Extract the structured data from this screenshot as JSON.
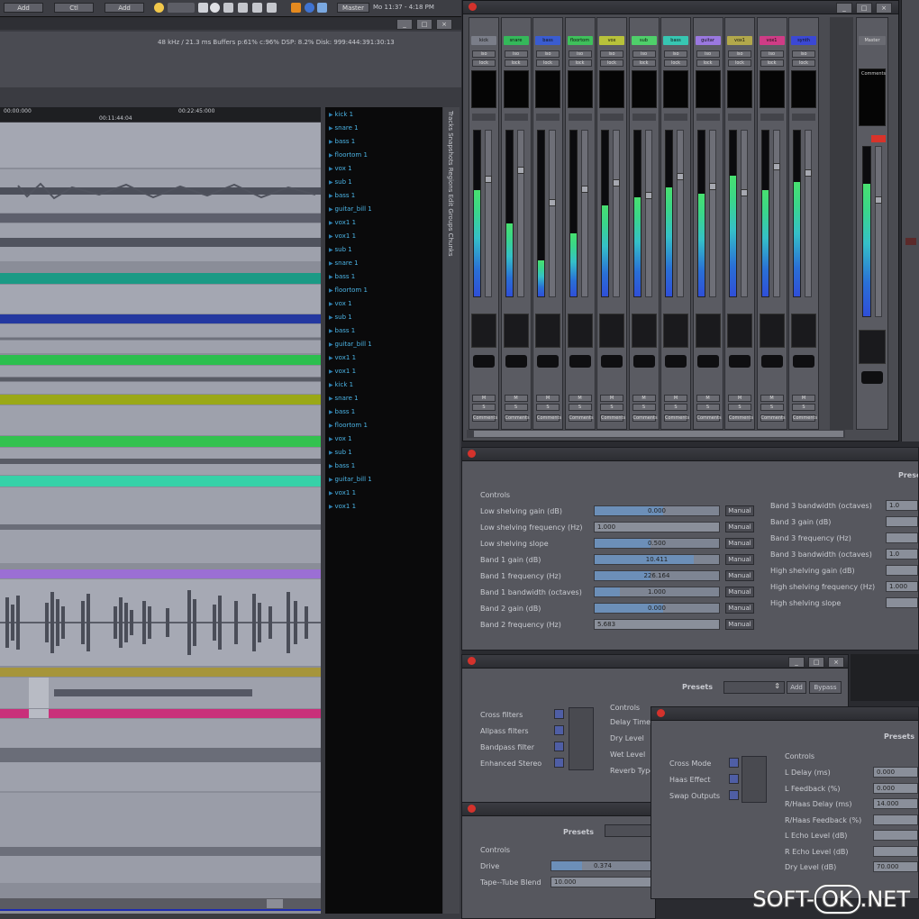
{
  "menubar": {
    "buttons": [
      "Add",
      "Ctl",
      "Add"
    ],
    "clock": "Mo 11:37 - 4:18 PM",
    "tray_label": "Master"
  },
  "status": {
    "info": "48 kHz / 21.3 ms  Buffers p:61% c:96%  DSP: 8.2%  Disk: 999:444:391:30:13"
  },
  "timeline": {
    "markers": [
      "00:00:000",
      "00:11:44:04",
      "00:22:45:000"
    ]
  },
  "tracks": {
    "names": [
      "kick 1",
      "snare 1",
      "bass 1",
      "floortom 1",
      "vox 1",
      "sub 1",
      "bass 1",
      "guitar_bill 1",
      "vox1 1",
      "vox1 1",
      "sub 1",
      "snare 1",
      "bass 1",
      "floortom 1",
      "vox 1",
      "sub 1",
      "bass 1",
      "guitar_bill 1",
      "vox1 1",
      "vox1 1",
      "kick 1",
      "snare 1",
      "bass 1",
      "floortom 1",
      "vox 1",
      "sub 1",
      "bass 1",
      "guitar_bill 1",
      "vox1 1",
      "vox1 1"
    ],
    "side_tabs": "Tracks  Snapshots  Regions  Edit Groups  Chunks",
    "colors": [
      "#1a9a85",
      "#2438a0",
      "#2bbf4e",
      "#9aa816",
      "#33c24f",
      "#36d1a8",
      "#9b6fd4",
      "#a6953a",
      "#c9307a",
      "#1c2bb0"
    ]
  },
  "mixer": {
    "strips": [
      {
        "name": "kick",
        "color": "#7a7d88",
        "meter": 0.64,
        "fader": 0.72
      },
      {
        "name": "snare",
        "color": "#34b85a",
        "meter": 0.44,
        "fader": 0.78
      },
      {
        "name": "bass",
        "color": "#3a5cd0",
        "meter": 0.22,
        "fader": 0.58
      },
      {
        "name": "floortom",
        "color": "#3fc05b",
        "meter": 0.38,
        "fader": 0.66
      },
      {
        "name": "vox",
        "color": "#b8c23a",
        "meter": 0.55,
        "fader": 0.7
      },
      {
        "name": "sub",
        "color": "#4fcf6a",
        "meter": 0.6,
        "fader": 0.62
      },
      {
        "name": "bass",
        "color": "#37c6b2",
        "meter": 0.66,
        "fader": 0.74
      },
      {
        "name": "guitar",
        "color": "#9a78e0",
        "meter": 0.62,
        "fader": 0.68
      },
      {
        "name": "vox1",
        "color": "#b2a84b",
        "meter": 0.73,
        "fader": 0.64
      },
      {
        "name": "vox1",
        "color": "#cf3c86",
        "meter": 0.64,
        "fader": 0.8
      },
      {
        "name": "synth",
        "color": "#3b48d4",
        "meter": 0.69,
        "fader": 0.76
      }
    ],
    "master": {
      "name": "Master",
      "meter": 0.78,
      "fader": 0.7
    },
    "btn_labels": [
      "M",
      "S",
      "iso",
      "lock",
      "Comments"
    ]
  },
  "eq_plugin": {
    "header": "Presets",
    "section": "Controls",
    "left": [
      {
        "label": "Low shelving gain (dB)",
        "value": "0.000",
        "fill": 0.55
      },
      {
        "label": "Low shelving frequency (Hz)",
        "value": "1.000",
        "fill": 0.0
      },
      {
        "label": "Low shelving slope",
        "value": "0.500",
        "fill": 0.45
      },
      {
        "label": "Band 1 gain (dB)",
        "value": "10.411",
        "fill": 0.8
      },
      {
        "label": "Band 1 frequency (Hz)",
        "value": "226.164",
        "fill": 0.45
      },
      {
        "label": "Band 1 bandwidth (octaves)",
        "value": "1.000",
        "fill": 0.2
      },
      {
        "label": "Band 2 gain (dB)",
        "value": "0.000",
        "fill": 0.55
      },
      {
        "label": "Band 2 frequency (Hz)",
        "value": "5.683",
        "fill": 0.0
      }
    ],
    "manual": "Manual",
    "right": [
      "Band 3 bandwidth (octaves)",
      "Band 3 gain (dB)",
      "Band 3 frequency (Hz)",
      "Band 3 bandwidth (octaves)",
      "High shelving gain (dB)",
      "High shelving frequency (Hz)",
      "High shelving slope"
    ],
    "right_values": [
      "1.0",
      "",
      "",
      "1.0",
      "",
      "1.000",
      ""
    ]
  },
  "reverb_plugin": {
    "presets_label": "Presets",
    "add_label": "Add",
    "bypass_label": "Bypass",
    "checks": [
      "Cross filters",
      "Allpass filters",
      "Bandpass filter",
      "Enhanced Stereo"
    ],
    "controls_label": "Controls",
    "ctl_labels": [
      "Delay Time",
      "Dry Level",
      "Wet Level",
      "Reverb Type"
    ]
  },
  "delay_plugin": {
    "header": "Presets",
    "checks": [
      "Cross Mode",
      "Haas Effect",
      "Swap Outputs"
    ],
    "controls_label": "Controls",
    "params": [
      {
        "label": "L Delay (ms)",
        "value": "0.000"
      },
      {
        "label": "L Feedback (%)",
        "value": "0.000"
      },
      {
        "label": "R/Haas Delay (ms)",
        "value": "14.000"
      },
      {
        "label": "R/Haas Feedback (%)",
        "value": ""
      },
      {
        "label": "L Echo Level (dB)",
        "value": ""
      },
      {
        "label": "R Echo Level (dB)",
        "value": ""
      },
      {
        "label": "Dry Level (dB)",
        "value": "70.000"
      }
    ]
  },
  "tape_plugin": {
    "header": "Presets",
    "controls_label": "Controls",
    "params": [
      {
        "label": "Drive",
        "value": "0.374"
      },
      {
        "label": "Tape--Tube Blend",
        "value": "10.000"
      }
    ]
  },
  "watermark": {
    "pre": "SOFT-",
    "ok": "OK",
    "post": ".NET"
  }
}
